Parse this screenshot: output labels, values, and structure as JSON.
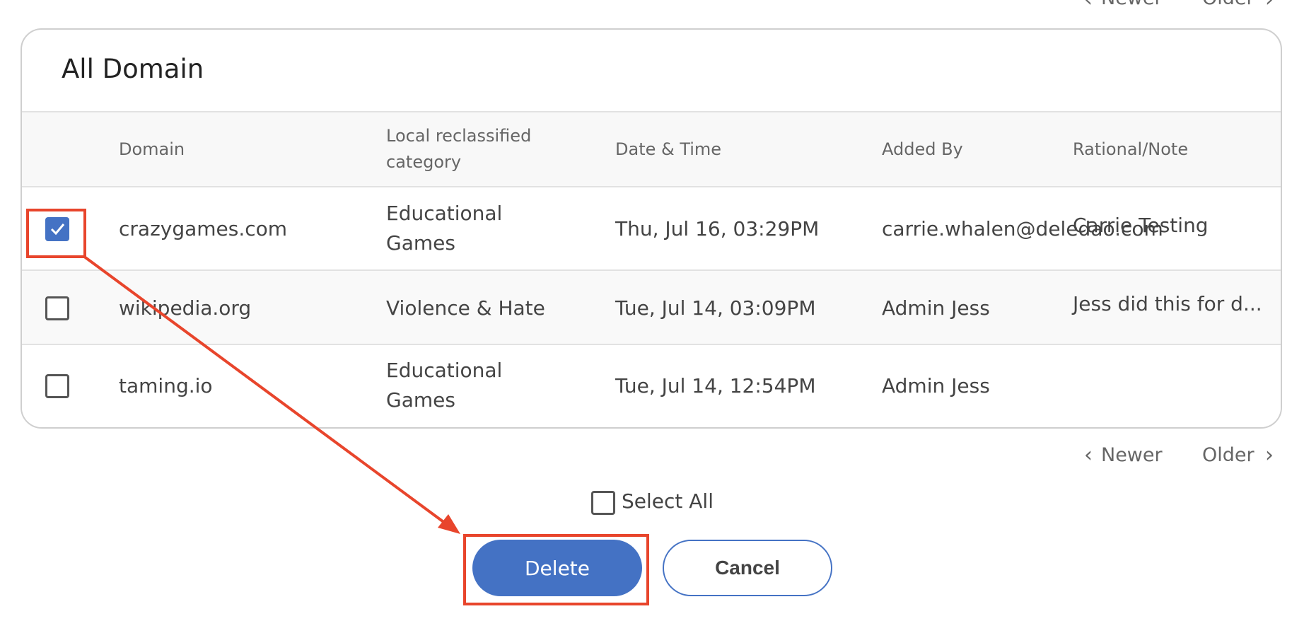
{
  "pagination": {
    "newer_label": "Newer",
    "older_label": "Older"
  },
  "card": {
    "title": "All Domain"
  },
  "table": {
    "columns": [
      "Domain",
      "Local reclassified category",
      "Date & Time",
      "Added By",
      "Rational/Note"
    ],
    "rows": [
      {
        "checked": true,
        "domain": "crazygames.com",
        "category": "Educational Games",
        "datetime": "Thu, Jul 16, 03:29PM",
        "added_by": "carrie.whalen@deledao.com",
        "note": "Carrie Testing"
      },
      {
        "checked": false,
        "domain": "wikipedia.org",
        "category": "Violence & Hate",
        "datetime": "Tue, Jul 14, 03:09PM",
        "added_by": "Admin Jess",
        "note": "Jess did this for d..."
      },
      {
        "checked": false,
        "domain": "taming.io",
        "category": "Educational Games",
        "datetime": "Tue, Jul 14, 12:54PM",
        "added_by": "Admin Jess",
        "note": ""
      }
    ]
  },
  "select_all_label": "Select All",
  "actions": {
    "delete_label": "Delete",
    "cancel_label": "Cancel"
  },
  "colors": {
    "accent": "#4472c4",
    "annotation": "#e8452c"
  }
}
